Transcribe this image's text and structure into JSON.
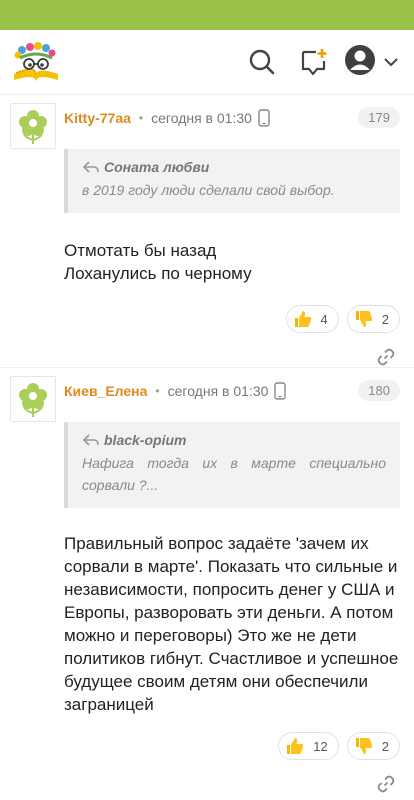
{
  "app": {
    "status_bar_color": "#9bc34a",
    "accent": "#e0891c",
    "icons": [
      "logo-icon",
      "search-icon",
      "new-post-icon",
      "profile-icon",
      "chevron-down-icon"
    ]
  },
  "comments": [
    {
      "author": "Kitty-77aa",
      "time": "сегодня в 01:30",
      "number": "179",
      "quote_author": "Соната любви",
      "quote_text": "в 2019 году люди сделали свой выбор.",
      "text_lines": [
        "Отмотать бы назад",
        "Лоханулись по черному"
      ],
      "likes": "4",
      "dislikes": "2"
    },
    {
      "author": "Киев_Елена",
      "time": "сегодня в 01:30",
      "number": "180",
      "quote_author": "black-opium",
      "quote_text": "Нафига тогда их в марте специально сорвали ?...",
      "text": "Правильный вопрос задаёте 'зачем их сорвали в марте'. Показать что сильные и независимости, попросить денег у США и Европы, разворовать эти деньги. А потом можно и переговоры) Это же не дети политиков гибнут. Счастливое и успешное будущее своим детям они обеспечили заграницей",
      "likes": "12",
      "dislikes": "2"
    }
  ]
}
